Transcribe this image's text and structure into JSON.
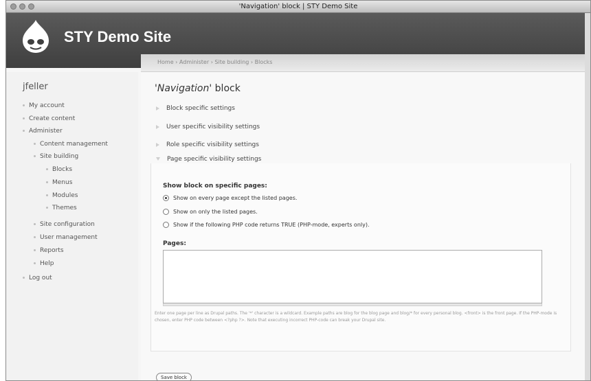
{
  "window": {
    "title": "'Navigation' block | STY Demo Site"
  },
  "header": {
    "site_name": "STY Demo Site"
  },
  "breadcrumb": "Home › Administer › Site building › Blocks",
  "sidebar": {
    "username": "jfeller",
    "items": [
      {
        "label": "My account"
      },
      {
        "label": "Create content"
      },
      {
        "label": "Administer"
      },
      {
        "label": "Content management"
      },
      {
        "label": "Site building"
      },
      {
        "label": "Blocks"
      },
      {
        "label": "Menus"
      },
      {
        "label": "Modules"
      },
      {
        "label": "Themes"
      },
      {
        "label": "Site configuration"
      },
      {
        "label": "User management"
      },
      {
        "label": "Reports"
      },
      {
        "label": "Help"
      },
      {
        "label": "Log out"
      }
    ]
  },
  "main": {
    "title_em": "'Navigation'",
    "title_rest": " block",
    "sections": [
      {
        "label": "Block specific settings"
      },
      {
        "label": "User specific visibility settings"
      },
      {
        "label": "Role specific visibility settings"
      }
    ],
    "page_visibility": {
      "legend": "Page specific visibility settings",
      "show_block_label": "Show block on specific pages:",
      "options": [
        {
          "label": "Show on every page except the listed pages.",
          "checked": true
        },
        {
          "label": "Show on only the listed pages.",
          "checked": false
        },
        {
          "label": "Show if the following PHP code returns TRUE (PHP-mode, experts only).",
          "checked": false
        }
      ],
      "pages_label": "Pages:",
      "pages_value": "",
      "help_text": "Enter one page per line as Drupal paths. The '*' character is a wildcard. Example paths are blog for the blog page and blog/* for every personal blog. <front> is the front page. If the PHP-mode is chosen, enter PHP code between <?php ?>. Note that executing incorrect PHP-code can break your Drupal site."
    },
    "save_button_label": "Save block"
  }
}
